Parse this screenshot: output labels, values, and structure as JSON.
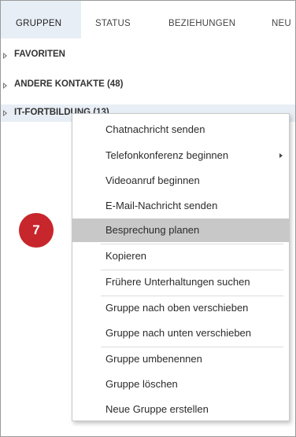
{
  "tabs": [
    {
      "label": "GRUPPEN",
      "active": true
    },
    {
      "label": "STATUS",
      "active": false
    },
    {
      "label": "BEZIEHUNGEN",
      "active": false
    },
    {
      "label": "NEU",
      "active": false
    }
  ],
  "groups": [
    {
      "label": "FAVORITEN"
    },
    {
      "label": "ANDERE KONTAKTE (48)"
    },
    {
      "label": "IT-FORTBILDUNG (13)"
    }
  ],
  "context_menu": {
    "items": [
      {
        "label": "Chatnachricht senden"
      },
      {
        "label": "Telefonkonferenz beginnen",
        "has_submenu": true
      },
      {
        "label": "Videoanruf beginnen"
      },
      {
        "label": "E-Mail-Nachricht senden"
      },
      {
        "label": "Besprechung planen",
        "highlighted": true
      },
      {
        "label": "Kopieren"
      },
      {
        "label": "Frühere Unterhaltungen suchen"
      },
      {
        "label": "Gruppe nach oben verschieben"
      },
      {
        "label": "Gruppe nach unten verschieben"
      },
      {
        "label": "Gruppe umbenennen"
      },
      {
        "label": "Gruppe löschen"
      },
      {
        "label": "Neue Gruppe erstellen"
      }
    ]
  },
  "step_badge": {
    "number": "7",
    "color": "#c7262c"
  },
  "colors": {
    "active_tab_bg": "#e8eef5",
    "menu_highlight": "#c8c8c8"
  }
}
